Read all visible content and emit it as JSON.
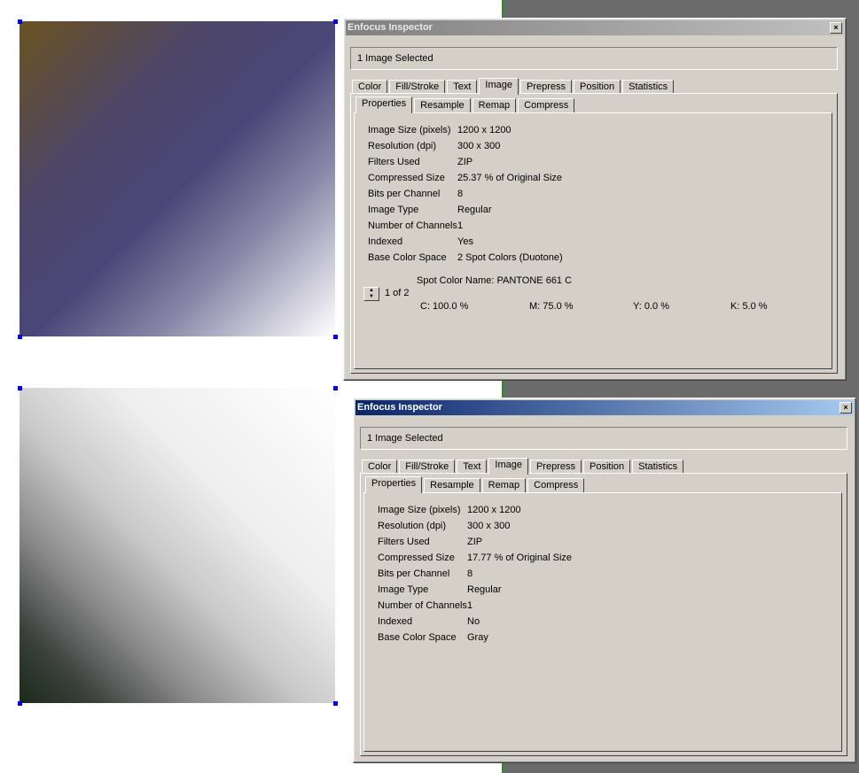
{
  "colors": {
    "window_bg": "#d4d0c8",
    "active_title": "#0a246a",
    "inactive_title": "#808080",
    "selection_handle": "#0000ee"
  },
  "inspector_top": {
    "title": "Enfocus Inspector",
    "status": "1 Image Selected",
    "tabs": [
      "Color",
      "Fill/Stroke",
      "Text",
      "Image",
      "Prepress",
      "Position",
      "Statistics"
    ],
    "subtabs": [
      "Properties",
      "Resample",
      "Remap",
      "Compress"
    ],
    "properties": [
      {
        "label": "Image Size (pixels)",
        "value": "1200 x 1200"
      },
      {
        "label": "Resolution (dpi)",
        "value": "300 x 300"
      },
      {
        "label": "Filters Used",
        "value": "ZIP"
      },
      {
        "label": "Compressed Size",
        "value": "25.37 % of Original Size"
      },
      {
        "label": "Bits per Channel",
        "value": "8"
      },
      {
        "label": "Image Type",
        "value": "Regular"
      },
      {
        "label": "Number of Channels",
        "value": "1"
      },
      {
        "label": "Indexed",
        "value": "Yes"
      },
      {
        "label": "Base Color Space",
        "value": "2 Spot Colors (Duotone)"
      }
    ],
    "spot": {
      "name_text": "Spot Color Name: PANTONE 661 C",
      "counter": "1  of  2",
      "c": "C:  100.0  %",
      "m": "M:  75.0  %",
      "y": "Y:  0.0  %",
      "k": "K:  5.0  %"
    }
  },
  "inspector_bottom": {
    "title": "Enfocus Inspector",
    "status": "1 Image Selected",
    "tabs": [
      "Color",
      "Fill/Stroke",
      "Text",
      "Image",
      "Prepress",
      "Position",
      "Statistics"
    ],
    "subtabs": [
      "Properties",
      "Resample",
      "Remap",
      "Compress"
    ],
    "properties": [
      {
        "label": "Image Size (pixels)",
        "value": "1200 x 1200"
      },
      {
        "label": "Resolution (dpi)",
        "value": "300 x 300"
      },
      {
        "label": "Filters Used",
        "value": "ZIP"
      },
      {
        "label": "Compressed Size",
        "value": "17.77 % of Original Size"
      },
      {
        "label": "Bits per Channel",
        "value": "8"
      },
      {
        "label": "Image Type",
        "value": "Regular"
      },
      {
        "label": "Number of Channels",
        "value": "1"
      },
      {
        "label": "Indexed",
        "value": "No"
      },
      {
        "label": "Base Color Space",
        "value": "Gray"
      }
    ]
  }
}
